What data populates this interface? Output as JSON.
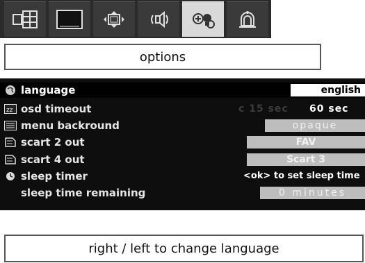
{
  "tabs": [
    {
      "icon": "layout-icon",
      "active": false
    },
    {
      "icon": "screen-icon",
      "active": false
    },
    {
      "icon": "picture-adjust-icon",
      "active": false
    },
    {
      "icon": "sound-icon",
      "active": false
    },
    {
      "icon": "options-icon",
      "active": true
    },
    {
      "icon": "install-icon",
      "active": false
    }
  ],
  "header": {
    "title": "options"
  },
  "menu": [
    {
      "label": "language",
      "value": "english"
    },
    {
      "label": "osd timeout",
      "value_dim": "c 15 sec",
      "value": "60 sec"
    },
    {
      "label": "menu backround",
      "value": "opaque"
    },
    {
      "label": "scart 2 out",
      "value": "FAV"
    },
    {
      "label": "scart 4 out",
      "value": "Scart 3"
    },
    {
      "label": "sleep timer",
      "value": "<ok> to set sleep time"
    },
    {
      "label": "sleep time remaining",
      "value": "0 minutes"
    }
  ],
  "footer": {
    "hint": "right / left to change language"
  },
  "colors": {
    "panel": "#0e0e0e",
    "highlight": "#ffffff",
    "grey_field": "#bdbdbd"
  }
}
